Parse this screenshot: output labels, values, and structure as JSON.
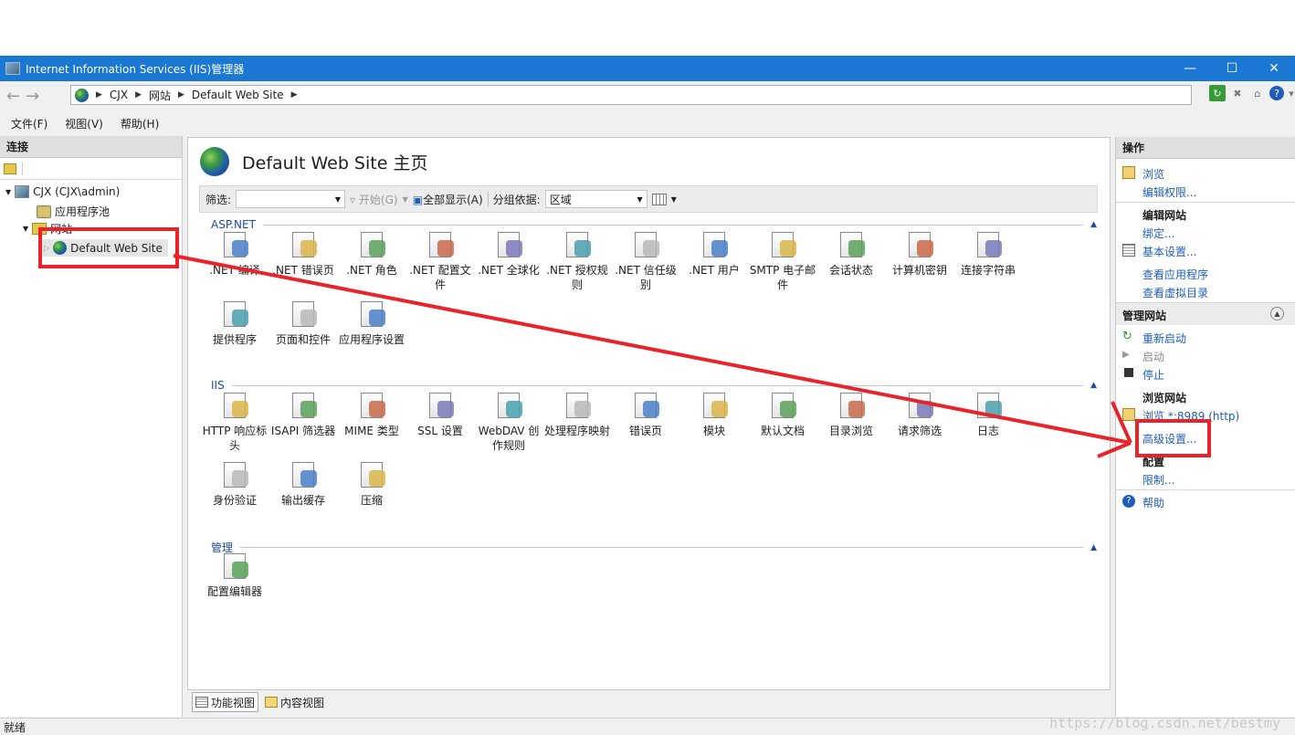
{
  "window": {
    "title": "Internet Information Services (IIS)管理器",
    "controls": [
      "minimize-icon",
      "maximize-icon",
      "close-icon"
    ]
  },
  "address": {
    "crumbs": [
      "CJX",
      "网站",
      "Default Web Site"
    ]
  },
  "menu": {
    "items": [
      "文件(F)",
      "视图(V)",
      "帮助(H)"
    ]
  },
  "connections": {
    "header": "连接",
    "tree": {
      "server": "CJX (CJX\\admin)",
      "apppools": "应用程序池",
      "sites": "网站",
      "site": "Default Web Site"
    }
  },
  "main": {
    "title": "Default Web Site 主页",
    "filter": {
      "label": "筛选:",
      "go": "开始(G)",
      "showall": "全部显示(A)",
      "groupby_label": "分组依据:",
      "groupby_value": "区域"
    },
    "groups": [
      {
        "name": "ASP.NET",
        "items": [
          ".NET 编译",
          ".NET 错误页",
          ".NET 角色",
          ".NET 配置文件",
          ".NET 全球化",
          ".NET 授权规则",
          ".NET 信任级别",
          ".NET 用户",
          "SMTP 电子邮件",
          "会话状态",
          "计算机密钥",
          "连接字符串",
          "提供程序",
          "页面和控件",
          "应用程序设置"
        ]
      },
      {
        "name": "IIS",
        "items": [
          "HTTP 响应标头",
          "ISAPI 筛选器",
          "MIME 类型",
          "SSL 设置",
          "WebDAV 创作规则",
          "处理程序映射",
          "错误页",
          "模块",
          "默认文档",
          "目录浏览",
          "请求筛选",
          "日志",
          "身份验证",
          "输出缓存",
          "压缩"
        ]
      },
      {
        "name": "管理",
        "items": [
          "配置编辑器"
        ]
      }
    ],
    "tabs": [
      "功能视图",
      "内容视图"
    ]
  },
  "actions": {
    "header": "操作",
    "browse": "浏览",
    "edit_perms": "编辑权限...",
    "edit_site": "编辑网站",
    "bindings": "绑定...",
    "basic": "基本设置...",
    "view_apps": "查看应用程序",
    "view_vdirs": "查看虚拟目录",
    "manage_site": "管理网站",
    "restart": "重新启动",
    "start": "启动",
    "stop": "停止",
    "browse_site": "浏览网站",
    "browse_port": "浏览 *:8989 (http)",
    "advanced": "高级设置...",
    "config": "配置",
    "limits": "限制...",
    "help": "帮助"
  },
  "status": {
    "text": "就绪"
  },
  "watermark": "https://blog.csdn.net/bestmy",
  "colors": {
    "titlebar": "#1a77d2",
    "link": "#1f5eb8",
    "annotation": "#e8232a"
  }
}
